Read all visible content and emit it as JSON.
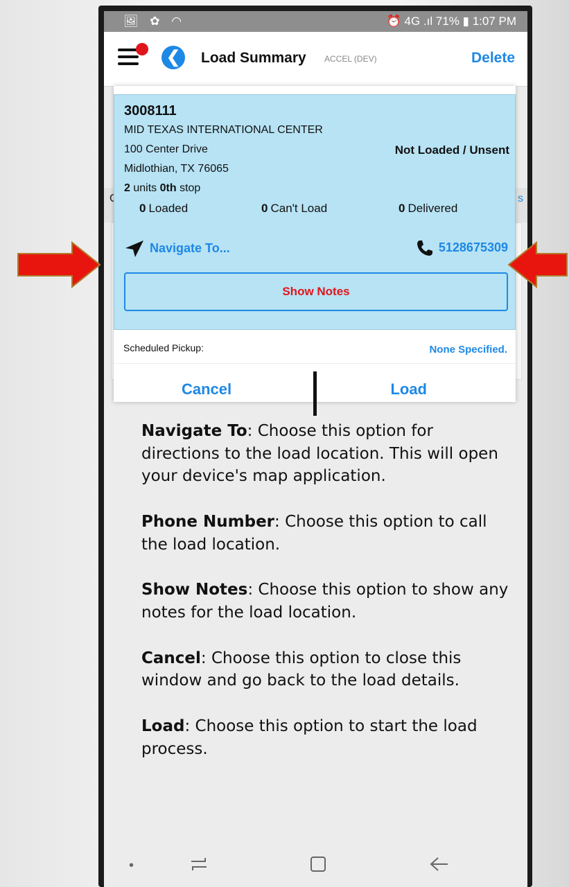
{
  "status_bar": {
    "left_icons": "🖼 ✿ ◠",
    "right_text": "⏰ 4G .ıl 71% ▮ 1:07 PM"
  },
  "app_bar": {
    "title": "Load Summary",
    "environment": "ACCEL (DEV)",
    "delete_label": "Delete",
    "menu_icon": "hamburger-icon",
    "back_icon": "back-arrow-icon"
  },
  "background": {
    "left_fragment": "C",
    "right_fragment": "s"
  },
  "dialog": {
    "load_id": "3008111",
    "location_name": "MID TEXAS INTERNATIONAL CENTER",
    "address_line1": "100 Center Drive",
    "address_line2": "Midlothian, TX 76065",
    "status": "Not Loaded / Unsent",
    "units_count": "2",
    "units_label": "units",
    "stop_number": "0th",
    "stop_label": "stop",
    "counts": [
      {
        "value": "0",
        "label": "Loaded"
      },
      {
        "value": "0",
        "label": "Can't Load"
      },
      {
        "value": "0",
        "label": "Delivered"
      }
    ],
    "navigate_label": "Navigate To...",
    "phone_number": "5128675309",
    "show_notes_label": "Show Notes",
    "scheduled_pickup_label": "Scheduled Pickup:",
    "scheduled_pickup_value": "None Specified.",
    "cancel_label": "Cancel",
    "load_label": "Load"
  },
  "help": [
    {
      "term": "Navigate To",
      "text": ": Choose this option for directions to the load location. This will open your device's map application."
    },
    {
      "term": "Phone Number",
      "text": ": Choose this option to call the load location."
    },
    {
      "term": "Show Notes",
      "text": ": Choose this option to show any notes for the load location."
    },
    {
      "term": "Cancel",
      "text": ": Choose this option to close this window and go back to the load details."
    },
    {
      "term": "Load",
      "text": ": Choose this option to start the load process."
    }
  ],
  "nav_bar": {
    "dot": "•",
    "recents_icon": "recents-icon",
    "home_icon": "home-icon",
    "back_icon": "back-icon"
  },
  "colors": {
    "accent": "#1e88e5",
    "card": "#b7e3f4",
    "alert": "#e0151b",
    "arrow": "#e8150f"
  }
}
